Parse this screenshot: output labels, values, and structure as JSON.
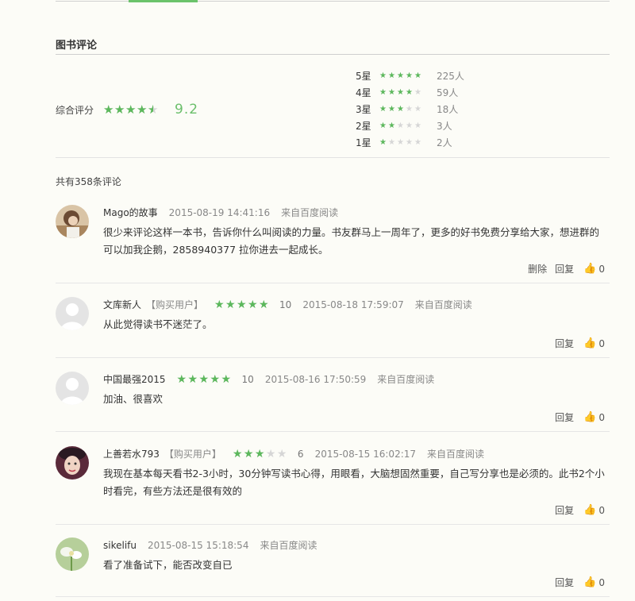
{
  "section": {
    "title": "图书评论"
  },
  "overall": {
    "label": "综合评分",
    "score": "9.2",
    "stars": [
      1,
      1,
      1,
      1,
      0.55
    ]
  },
  "distribution": [
    {
      "label": "5星",
      "count": "225人",
      "stars": [
        1,
        1,
        1,
        1,
        1
      ]
    },
    {
      "label": "4星",
      "count": "59人",
      "stars": [
        1,
        1,
        1,
        1,
        0
      ]
    },
    {
      "label": "3星",
      "count": "18人",
      "stars": [
        1,
        1,
        1,
        0,
        0
      ]
    },
    {
      "label": "2星",
      "count": "3人",
      "stars": [
        1,
        1,
        0,
        0,
        0
      ]
    },
    {
      "label": "1星",
      "count": "2人",
      "stars": [
        1,
        0,
        0,
        0,
        0
      ]
    }
  ],
  "summary": {
    "text": "共有358条评论"
  },
  "actions": {
    "delete": "删除",
    "reply": "回复",
    "likes": "0"
  },
  "reviews": [
    {
      "author": "Mago的故事",
      "time": "2015-08-19 14:41:16",
      "source": "来自百度阅读",
      "text": "很少来评论这样一本书，告诉你什么叫阅读的力量。书友群马上一周年了，更多的好书免费分享给大家，想进群的可以加我企鹅，2858940377 拉你进去一起成长。"
    },
    {
      "author": "文库新人",
      "buyer_tag": "【购买用户】",
      "score": "10",
      "stars": [
        1,
        1,
        1,
        1,
        1
      ],
      "time": "2015-08-18 17:59:07",
      "source": "来自百度阅读",
      "text": "从此觉得读书不迷茫了。"
    },
    {
      "author": "中国最强2015",
      "score": "10",
      "stars": [
        1,
        1,
        1,
        1,
        1
      ],
      "time": "2015-08-16 17:50:59",
      "source": "来自百度阅读",
      "text": "加油、很喜欢"
    },
    {
      "author": "上善若水793",
      "buyer_tag": "【购买用户】",
      "score": "6",
      "stars": [
        1,
        1,
        1,
        0,
        0
      ],
      "time": "2015-08-15 16:02:17",
      "source": "来自百度阅读",
      "text": "我现在基本每天看书2-3小时，30分钟写读书心得，用眼看，大脑想固然重要，自己写分享也是必须的。此书2个小时看完，有些方法还是很有效的"
    },
    {
      "author": "sikelifu",
      "time": "2015-08-15 15:18:54",
      "source": "来自百度阅读",
      "text": "看了准备试下，能否改变自已"
    }
  ],
  "colors": {
    "accent": "#5cb85c",
    "star_empty": "#d6d6d6",
    "background": "#fcfcf7"
  },
  "icons": {
    "star": "star-icon",
    "thumb": "thumbs-up-icon"
  }
}
